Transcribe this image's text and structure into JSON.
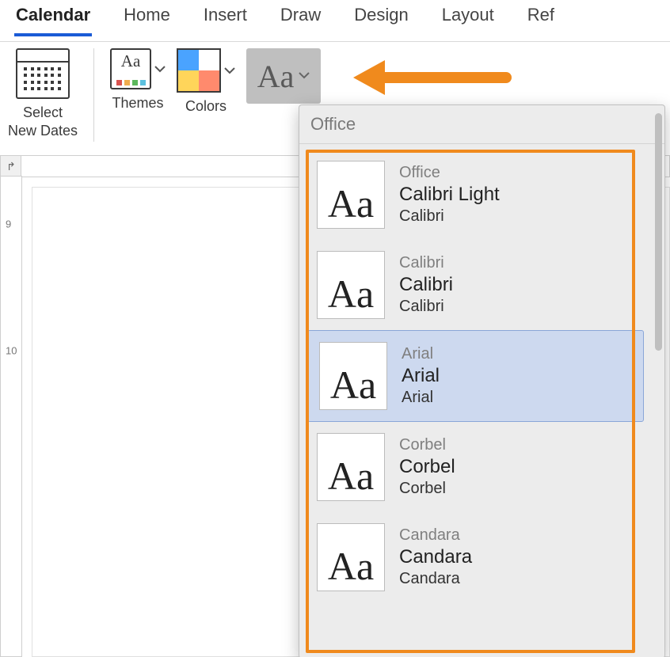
{
  "tabs": {
    "items": [
      "Calendar",
      "Home",
      "Insert",
      "Draw",
      "Design",
      "Layout",
      "Ref"
    ],
    "activeIndex": 0
  },
  "ribbon": {
    "selectDatesLine1": "Select",
    "selectDatesLine2": "New Dates",
    "themes": "Themes",
    "colors": "Colors"
  },
  "ruler": {
    "m9": "9",
    "m10": "10"
  },
  "panel": {
    "header": "Office",
    "items": [
      {
        "name": "Office",
        "heading": "Calibri Light",
        "body": "Calibri",
        "selected": false
      },
      {
        "name": "Calibri",
        "heading": "Calibri",
        "body": "Calibri",
        "selected": false
      },
      {
        "name": "Arial",
        "heading": "Arial",
        "body": "Arial",
        "selected": true
      },
      {
        "name": "Corbel",
        "heading": "Corbel",
        "body": "Corbel",
        "selected": false
      },
      {
        "name": "Candara",
        "heading": "Candara",
        "body": "Candara",
        "selected": false
      }
    ]
  }
}
